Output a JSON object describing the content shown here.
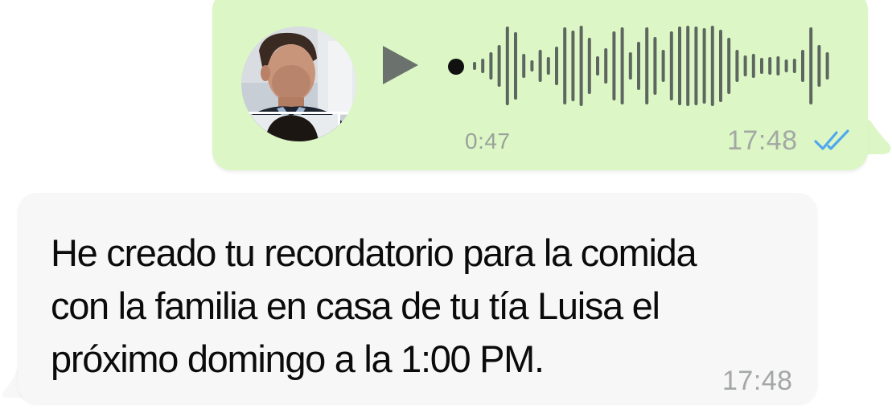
{
  "voice_message": {
    "duration": "0:47",
    "time": "17:48",
    "status": "read",
    "icons": {
      "avatar": "contact-photo",
      "play": "play-icon",
      "ticks": "double-check-icon"
    },
    "colors": {
      "bubble": "#dcf7c5",
      "waveform": "#5e6660",
      "ticks": "#4fa8ee"
    }
  },
  "text_message": {
    "text": "He creado tu recordatorio para la comida\ncon la familia en casa de tu tía Luisa el\npróximo domingo a la 1:00 PM.",
    "time": "17:48",
    "colors": {
      "bubble": "#f7f7f7"
    }
  }
}
